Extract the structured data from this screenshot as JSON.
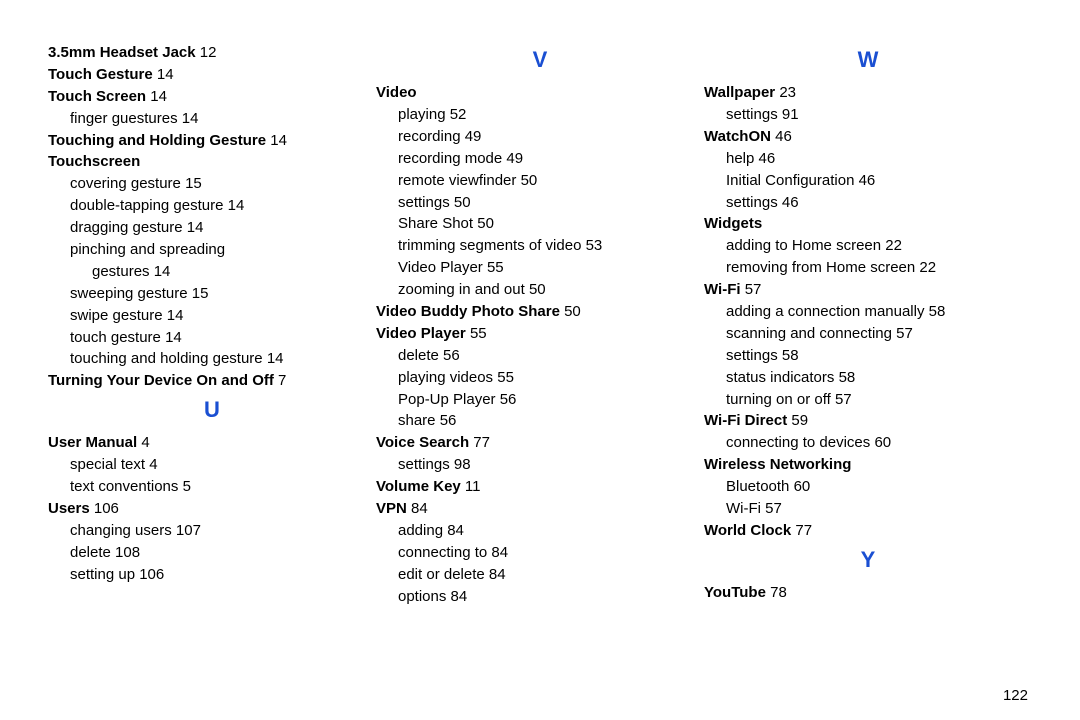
{
  "page_number": "122",
  "columns": [
    {
      "sections": [
        {
          "heading": null,
          "items": [
            {
              "level": 0,
              "bold": true,
              "text": "3.5mm Headset Jack",
              "page": "12"
            },
            {
              "level": 0,
              "bold": true,
              "text": "Touch Gesture",
              "page": "14"
            },
            {
              "level": 0,
              "bold": true,
              "text": "Touch Screen",
              "page": "14"
            },
            {
              "level": 1,
              "bold": false,
              "text": "finger guestures",
              "page": "14"
            },
            {
              "level": 0,
              "bold": true,
              "text": "Touching and Holding Gesture",
              "page": "14"
            },
            {
              "level": 0,
              "bold": true,
              "text": "Touchscreen",
              "page": ""
            },
            {
              "level": 1,
              "bold": false,
              "text": "covering gesture",
              "page": "15"
            },
            {
              "level": 1,
              "bold": false,
              "text": "double-tapping gesture",
              "page": "14"
            },
            {
              "level": 1,
              "bold": false,
              "text": "dragging gesture",
              "page": "14"
            },
            {
              "level": 1,
              "bold": false,
              "text": "pinching and spreading",
              "page": ""
            },
            {
              "level": 2,
              "bold": false,
              "text": "gestures",
              "page": "14"
            },
            {
              "level": 1,
              "bold": false,
              "text": "sweeping gesture",
              "page": "15"
            },
            {
              "level": 1,
              "bold": false,
              "text": "swipe gesture",
              "page": "14"
            },
            {
              "level": 1,
              "bold": false,
              "text": "touch gesture",
              "page": "14"
            },
            {
              "level": 1,
              "bold": false,
              "text": "touching and holding gesture",
              "page": "14"
            },
            {
              "level": 0,
              "bold": true,
              "text": "Turning Your Device On and Off",
              "page": "7"
            }
          ]
        },
        {
          "heading": "U",
          "items": [
            {
              "level": 0,
              "bold": true,
              "text": "User Manual",
              "page": "4"
            },
            {
              "level": 1,
              "bold": false,
              "text": "special text",
              "page": "4"
            },
            {
              "level": 1,
              "bold": false,
              "text": "text conventions",
              "page": "5"
            },
            {
              "level": 0,
              "bold": true,
              "text": "Users",
              "page": "106"
            },
            {
              "level": 1,
              "bold": false,
              "text": "changing users",
              "page": "107"
            },
            {
              "level": 1,
              "bold": false,
              "text": "delete",
              "page": "108"
            },
            {
              "level": 1,
              "bold": false,
              "text": "setting up",
              "page": "106"
            }
          ]
        }
      ]
    },
    {
      "sections": [
        {
          "heading": "V",
          "items": [
            {
              "level": 0,
              "bold": true,
              "text": "Video",
              "page": ""
            },
            {
              "level": 1,
              "bold": false,
              "text": "playing",
              "page": "52"
            },
            {
              "level": 1,
              "bold": false,
              "text": "recording",
              "page": "49"
            },
            {
              "level": 1,
              "bold": false,
              "text": "recording mode",
              "page": "49"
            },
            {
              "level": 1,
              "bold": false,
              "text": "remote viewfinder",
              "page": "50"
            },
            {
              "level": 1,
              "bold": false,
              "text": "settings",
              "page": "50"
            },
            {
              "level": 1,
              "bold": false,
              "text": "Share Shot",
              "page": "50"
            },
            {
              "level": 1,
              "bold": false,
              "text": "trimming segments of video",
              "page": "53"
            },
            {
              "level": 1,
              "bold": false,
              "text": "Video Player",
              "page": "55"
            },
            {
              "level": 1,
              "bold": false,
              "text": "zooming in and out",
              "page": "50"
            },
            {
              "level": 0,
              "bold": true,
              "text": "Video Buddy Photo Share",
              "page": "50"
            },
            {
              "level": 0,
              "bold": true,
              "text": "Video Player",
              "page": "55"
            },
            {
              "level": 1,
              "bold": false,
              "text": "delete",
              "page": "56"
            },
            {
              "level": 1,
              "bold": false,
              "text": "playing videos",
              "page": "55"
            },
            {
              "level": 1,
              "bold": false,
              "text": "Pop-Up Player",
              "page": "56"
            },
            {
              "level": 1,
              "bold": false,
              "text": "share",
              "page": "56"
            },
            {
              "level": 0,
              "bold": true,
              "text": "Voice Search",
              "page": "77"
            },
            {
              "level": 1,
              "bold": false,
              "text": "settings",
              "page": "98"
            },
            {
              "level": 0,
              "bold": true,
              "text": "Volume Key",
              "page": "11"
            },
            {
              "level": 0,
              "bold": true,
              "text": "VPN",
              "page": "84"
            },
            {
              "level": 1,
              "bold": false,
              "text": "adding",
              "page": "84"
            },
            {
              "level": 1,
              "bold": false,
              "text": "connecting to",
              "page": "84"
            },
            {
              "level": 1,
              "bold": false,
              "text": "edit or delete",
              "page": "84"
            },
            {
              "level": 1,
              "bold": false,
              "text": "options",
              "page": "84"
            }
          ]
        }
      ]
    },
    {
      "sections": [
        {
          "heading": "W",
          "items": [
            {
              "level": 0,
              "bold": true,
              "text": "Wallpaper",
              "page": "23"
            },
            {
              "level": 1,
              "bold": false,
              "text": "settings",
              "page": "91"
            },
            {
              "level": 0,
              "bold": true,
              "text": "WatchON",
              "page": "46"
            },
            {
              "level": 1,
              "bold": false,
              "text": "help",
              "page": "46"
            },
            {
              "level": 1,
              "bold": false,
              "text": "Initial Configuration",
              "page": "46"
            },
            {
              "level": 1,
              "bold": false,
              "text": "settings",
              "page": "46"
            },
            {
              "level": 0,
              "bold": true,
              "text": "Widgets",
              "page": ""
            },
            {
              "level": 1,
              "bold": false,
              "text": "adding to Home screen",
              "page": "22"
            },
            {
              "level": 1,
              "bold": false,
              "text": "removing from Home screen",
              "page": "22"
            },
            {
              "level": 0,
              "bold": true,
              "text": "Wi-Fi",
              "page": "57"
            },
            {
              "level": 1,
              "bold": false,
              "text": "adding a connection manually",
              "page": "58"
            },
            {
              "level": 1,
              "bold": false,
              "text": "scanning and connecting",
              "page": "57"
            },
            {
              "level": 1,
              "bold": false,
              "text": "settings",
              "page": "58"
            },
            {
              "level": 1,
              "bold": false,
              "text": "status indicators",
              "page": "58"
            },
            {
              "level": 1,
              "bold": false,
              "text": "turning on or off",
              "page": "57"
            },
            {
              "level": 0,
              "bold": true,
              "text": "Wi-Fi Direct",
              "page": "59"
            },
            {
              "level": 1,
              "bold": false,
              "text": "connecting to devices",
              "page": "60"
            },
            {
              "level": 0,
              "bold": true,
              "text": "Wireless Networking",
              "page": ""
            },
            {
              "level": 1,
              "bold": false,
              "text": "Bluetooth",
              "page": "60"
            },
            {
              "level": 1,
              "bold": false,
              "text": "Wi-Fi",
              "page": "57"
            },
            {
              "level": 0,
              "bold": true,
              "text": "World Clock",
              "page": "77"
            }
          ]
        },
        {
          "heading": "Y",
          "items": [
            {
              "level": 0,
              "bold": true,
              "text": "YouTube",
              "page": "78"
            }
          ]
        }
      ]
    }
  ]
}
